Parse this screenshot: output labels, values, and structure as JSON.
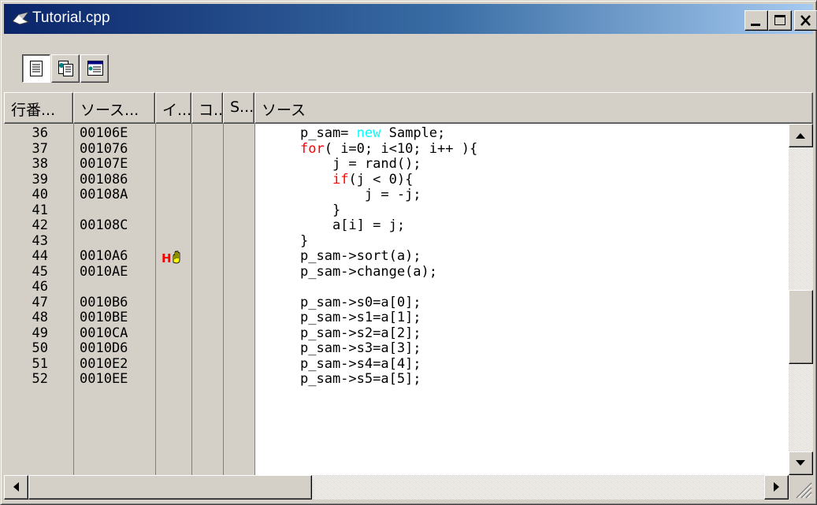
{
  "window": {
    "title": "Tutorial.cpp",
    "icon": "document-icon"
  },
  "title_buttons": {
    "minimize": "minimize-icon",
    "maximize": "maximize-icon",
    "close": "close-icon"
  },
  "toolbar": {
    "buttons": [
      {
        "icon": "source-view-icon",
        "pressed": true
      },
      {
        "icon": "disassembly-view-icon",
        "pressed": false
      },
      {
        "icon": "mixed-view-icon",
        "pressed": false
      }
    ]
  },
  "columns": [
    "行番...",
    "ソース...",
    "イ...",
    "コ...",
    "S...",
    "ソース"
  ],
  "rows": [
    {
      "line": "36",
      "addr": "00106E",
      "event": "",
      "code": [
        {
          "t": "p_sam= "
        },
        {
          "t": "new",
          "c": "blue"
        },
        {
          "t": " Sample;"
        }
      ]
    },
    {
      "line": "37",
      "addr": "001076",
      "event": "",
      "code": [
        {
          "t": "for",
          "c": "red"
        },
        {
          "t": "( i=0; i<10; i++ ){"
        }
      ]
    },
    {
      "line": "38",
      "addr": "00107E",
      "event": "",
      "code": [
        {
          "t": "    j = rand();"
        }
      ]
    },
    {
      "line": "39",
      "addr": "001086",
      "event": "",
      "code": [
        {
          "t": "    "
        },
        {
          "t": "if",
          "c": "red"
        },
        {
          "t": "(j < 0){"
        }
      ]
    },
    {
      "line": "40",
      "addr": "00108A",
      "event": "",
      "code": [
        {
          "t": "        j = -j;"
        }
      ]
    },
    {
      "line": "41",
      "addr": "",
      "event": "",
      "code": [
        {
          "t": "    }"
        }
      ]
    },
    {
      "line": "42",
      "addr": "00108C",
      "event": "",
      "code": [
        {
          "t": "    a[i] = j;"
        }
      ]
    },
    {
      "line": "43",
      "addr": "",
      "event": "",
      "code": [
        {
          "t": "}"
        }
      ]
    },
    {
      "line": "44",
      "addr": "0010A6",
      "event": "hardware-break-icon",
      "code": [
        {
          "t": "p_sam->sort(a);"
        }
      ]
    },
    {
      "line": "45",
      "addr": "0010AE",
      "event": "",
      "code": [
        {
          "t": "p_sam->change(a);"
        }
      ]
    },
    {
      "line": "46",
      "addr": "",
      "event": "",
      "code": [
        {
          "t": ""
        }
      ]
    },
    {
      "line": "47",
      "addr": "0010B6",
      "event": "",
      "code": [
        {
          "t": "p_sam->s0=a[0];"
        }
      ]
    },
    {
      "line": "48",
      "addr": "0010BE",
      "event": "",
      "code": [
        {
          "t": "p_sam->s1=a[1];"
        }
      ]
    },
    {
      "line": "49",
      "addr": "0010CA",
      "event": "",
      "code": [
        {
          "t": "p_sam->s2=a[2];"
        }
      ]
    },
    {
      "line": "50",
      "addr": "0010D6",
      "event": "",
      "code": [
        {
          "t": "p_sam->s3=a[3];"
        }
      ]
    },
    {
      "line": "51",
      "addr": "0010E2",
      "event": "",
      "code": [
        {
          "t": "p_sam->s4=a[4];"
        }
      ]
    },
    {
      "line": "52",
      "addr": "0010EE",
      "event": "",
      "code": [
        {
          "t": "p_sam->s5=a[5];"
        }
      ]
    }
  ],
  "event_mark_text": "H",
  "scrollbars": {
    "vertical_position": 0.62,
    "horizontal_position": 0.0
  },
  "colors": {
    "keyword_blue": "#00ffff",
    "keyword_red": "#ff0000",
    "title_start": "#0a246a",
    "title_end": "#a6caf0"
  }
}
